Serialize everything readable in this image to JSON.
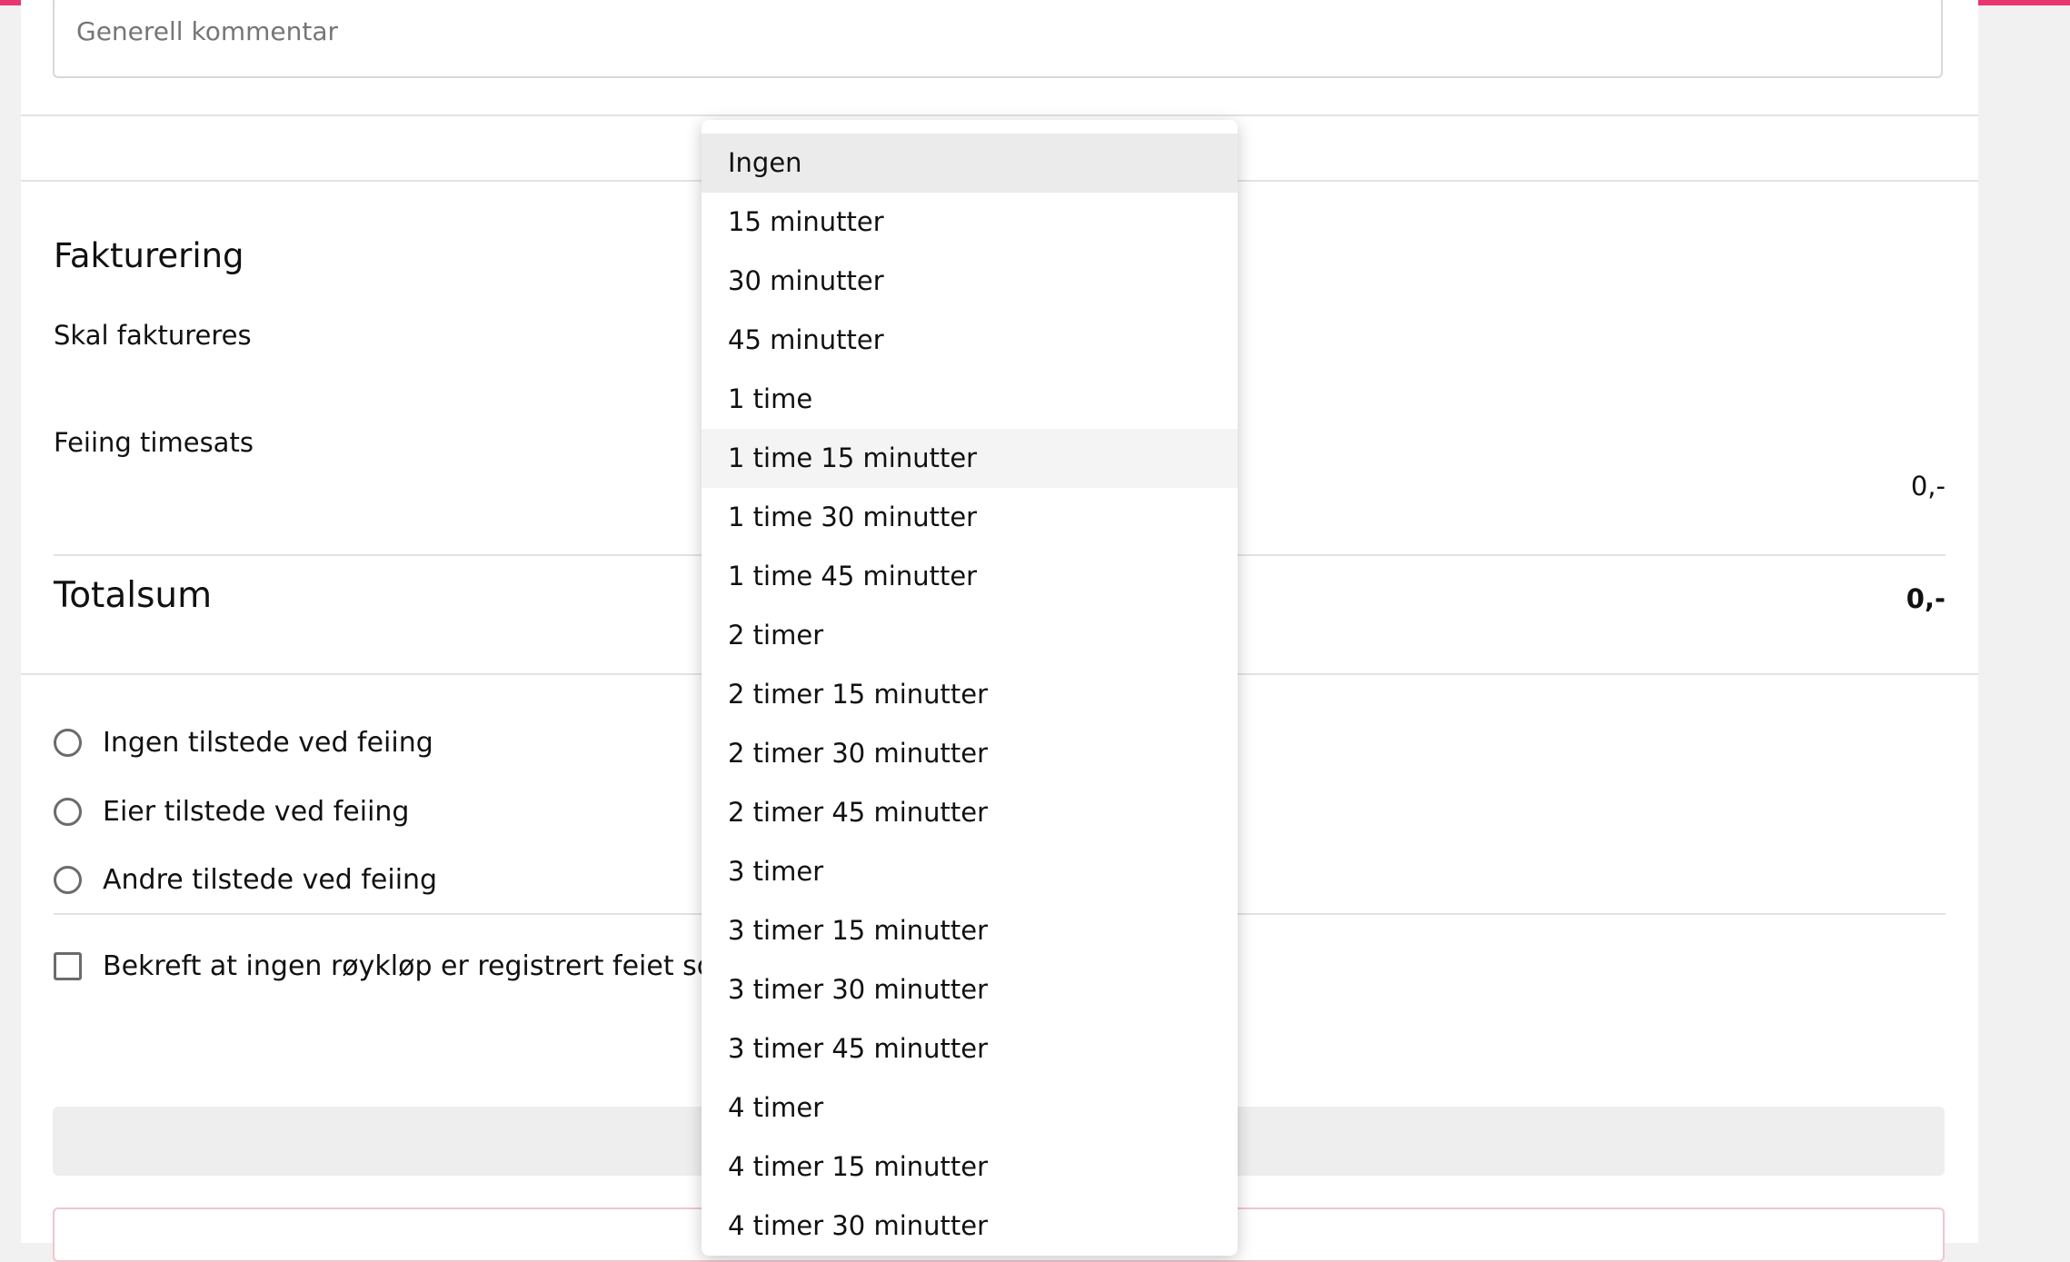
{
  "comment": {
    "placeholder": "Generell kommentar"
  },
  "billing": {
    "title": "Fakturering",
    "should_invoice_label": "Skal faktureres",
    "hourly_rate_label": "Feiing timesats",
    "hourly_rate_amount": "0,-"
  },
  "total": {
    "label": "Totalsum",
    "amount": "0,-"
  },
  "presence_options": [
    {
      "label": "Ingen tilstede ved feiing",
      "checked": false
    },
    {
      "label": "Eier tilstede ved feiing",
      "checked": false
    },
    {
      "label": "Andre tilstede ved feiing",
      "checked": false
    }
  ],
  "confirm": {
    "label": "Bekreft at ingen røykløp er registrert feiet som er",
    "checked": false
  },
  "duration_dropdown": {
    "selected_index": 0,
    "highlighted_index": 5,
    "options": [
      "Ingen",
      "15 minutter",
      "30 minutter",
      "45 minutter",
      "1 time",
      "1 time 15 minutter",
      "1 time 30 minutter",
      "1 time 45 minutter",
      "2 timer",
      "2 timer 15 minutter",
      "2 timer 30 minutter",
      "2 timer 45 minutter",
      "3 timer",
      "3 timer 15 minutter",
      "3 timer 30 minutter",
      "3 timer 45 minutter",
      "4 timer",
      "4 timer 15 minutter",
      "4 timer 30 minutter"
    ]
  },
  "colors": {
    "accent": "#e8366c",
    "selected_bg": "#ebebeb",
    "hover_bg": "#f4f4f4"
  }
}
